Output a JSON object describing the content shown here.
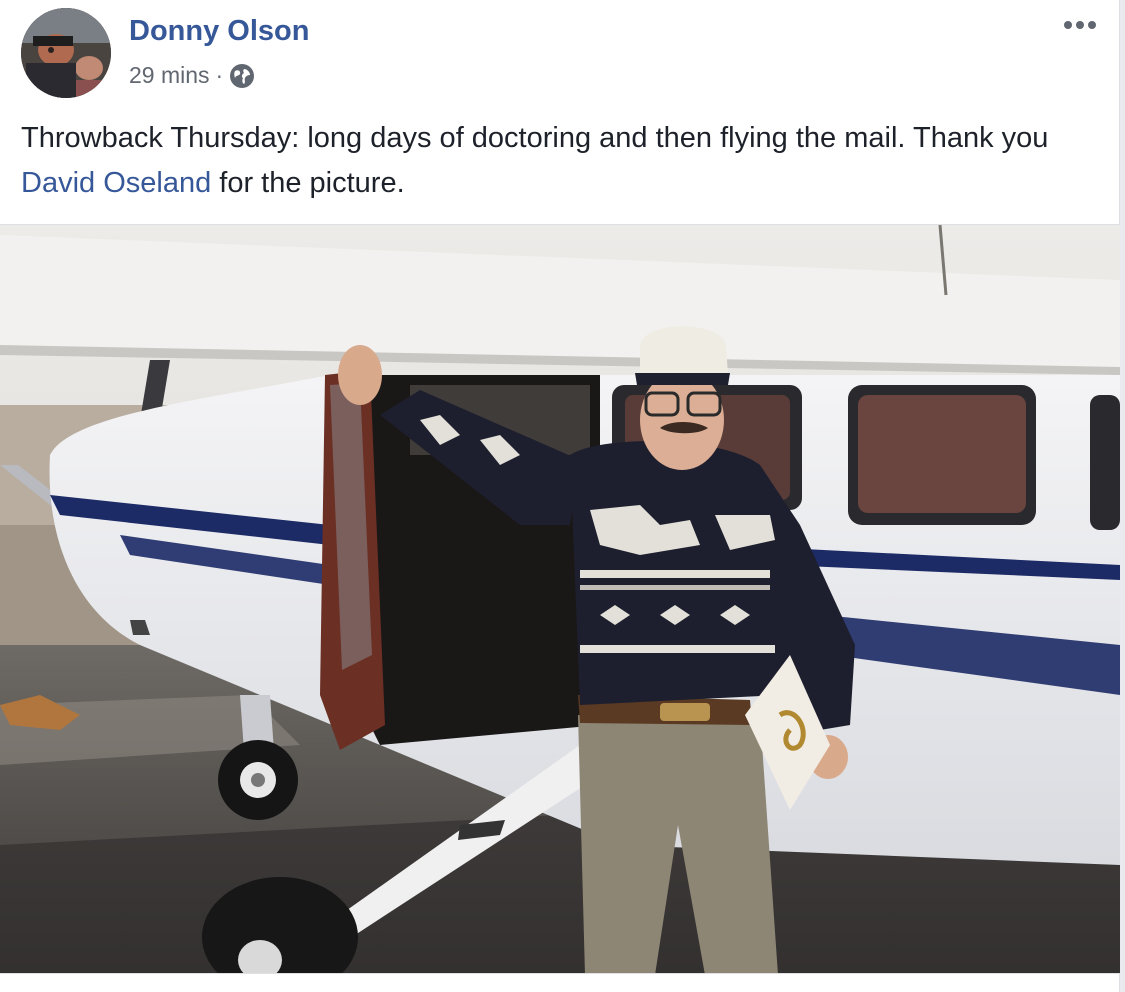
{
  "post": {
    "author": "Donny Olson",
    "timestamp": "29 mins",
    "separator": "·",
    "privacy_icon": "globe-icon",
    "more_icon": "more-options-icon",
    "text_before": "Throwback Thursday: long days of doctoring and then flying the mail. Thank you ",
    "mention": "David Oseland",
    "text_after": " for the picture."
  },
  "colors": {
    "link": "#365899",
    "text": "#1d2129",
    "meta": "#616770"
  }
}
